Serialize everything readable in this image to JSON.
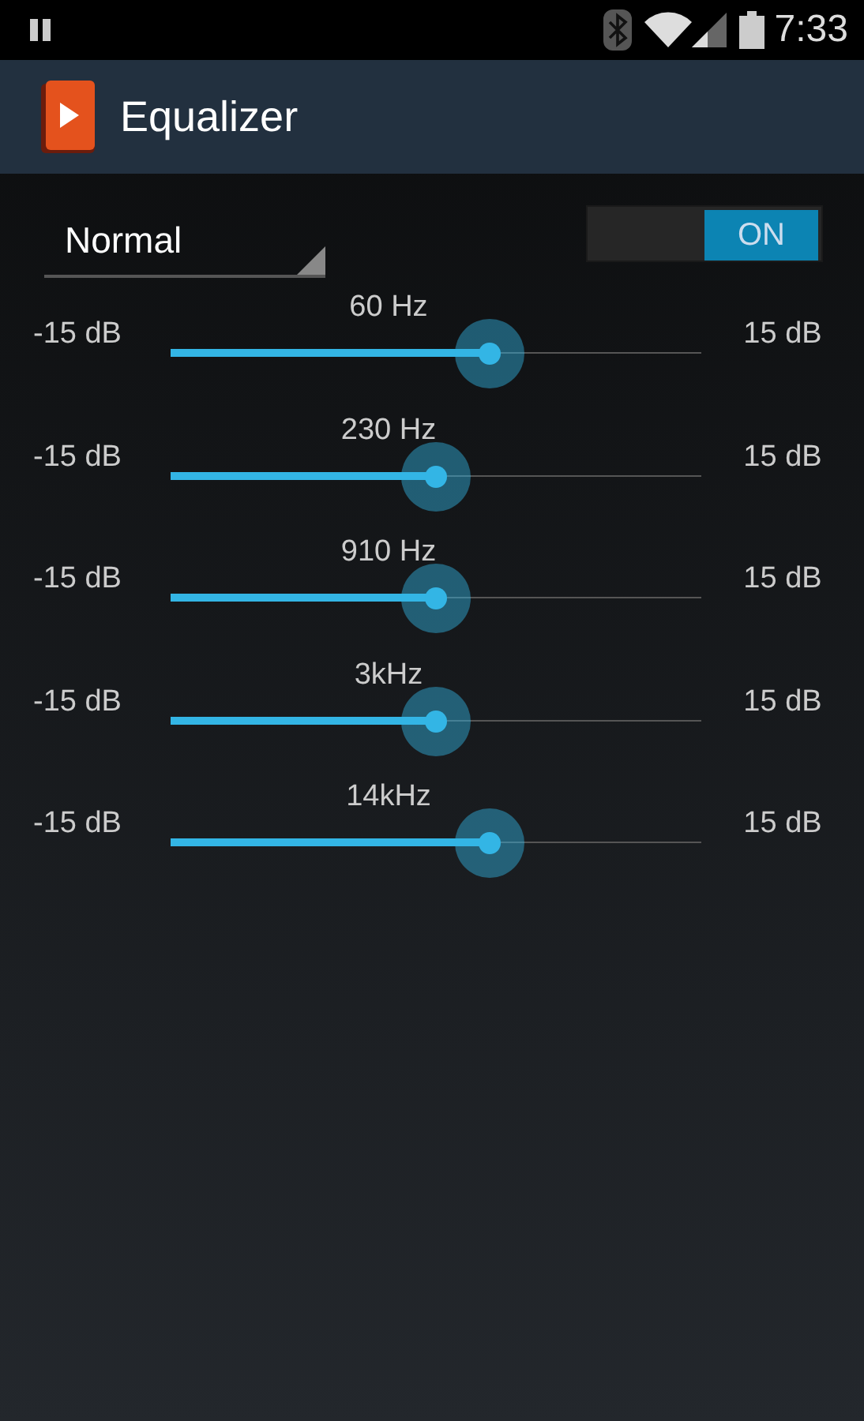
{
  "status_bar": {
    "time": "7:33"
  },
  "app_bar": {
    "title": "Equalizer"
  },
  "preset": {
    "value": "Normal"
  },
  "switch": {
    "label": "ON",
    "on": true
  },
  "bands": [
    {
      "frequency": "60 Hz",
      "min": "-15 dB",
      "max": "15 dB",
      "level": 0.6
    },
    {
      "frequency": "230 Hz",
      "min": "-15 dB",
      "max": "15 dB",
      "level": 0.5
    },
    {
      "frequency": "910 Hz",
      "min": "-15 dB",
      "max": "15 dB",
      "level": 0.5
    },
    {
      "frequency": "3kHz",
      "min": "-15 dB",
      "max": "15 dB",
      "level": 0.5
    },
    {
      "frequency": "14kHz",
      "min": "-15 dB",
      "max": "15 dB",
      "level": 0.6
    }
  ]
}
